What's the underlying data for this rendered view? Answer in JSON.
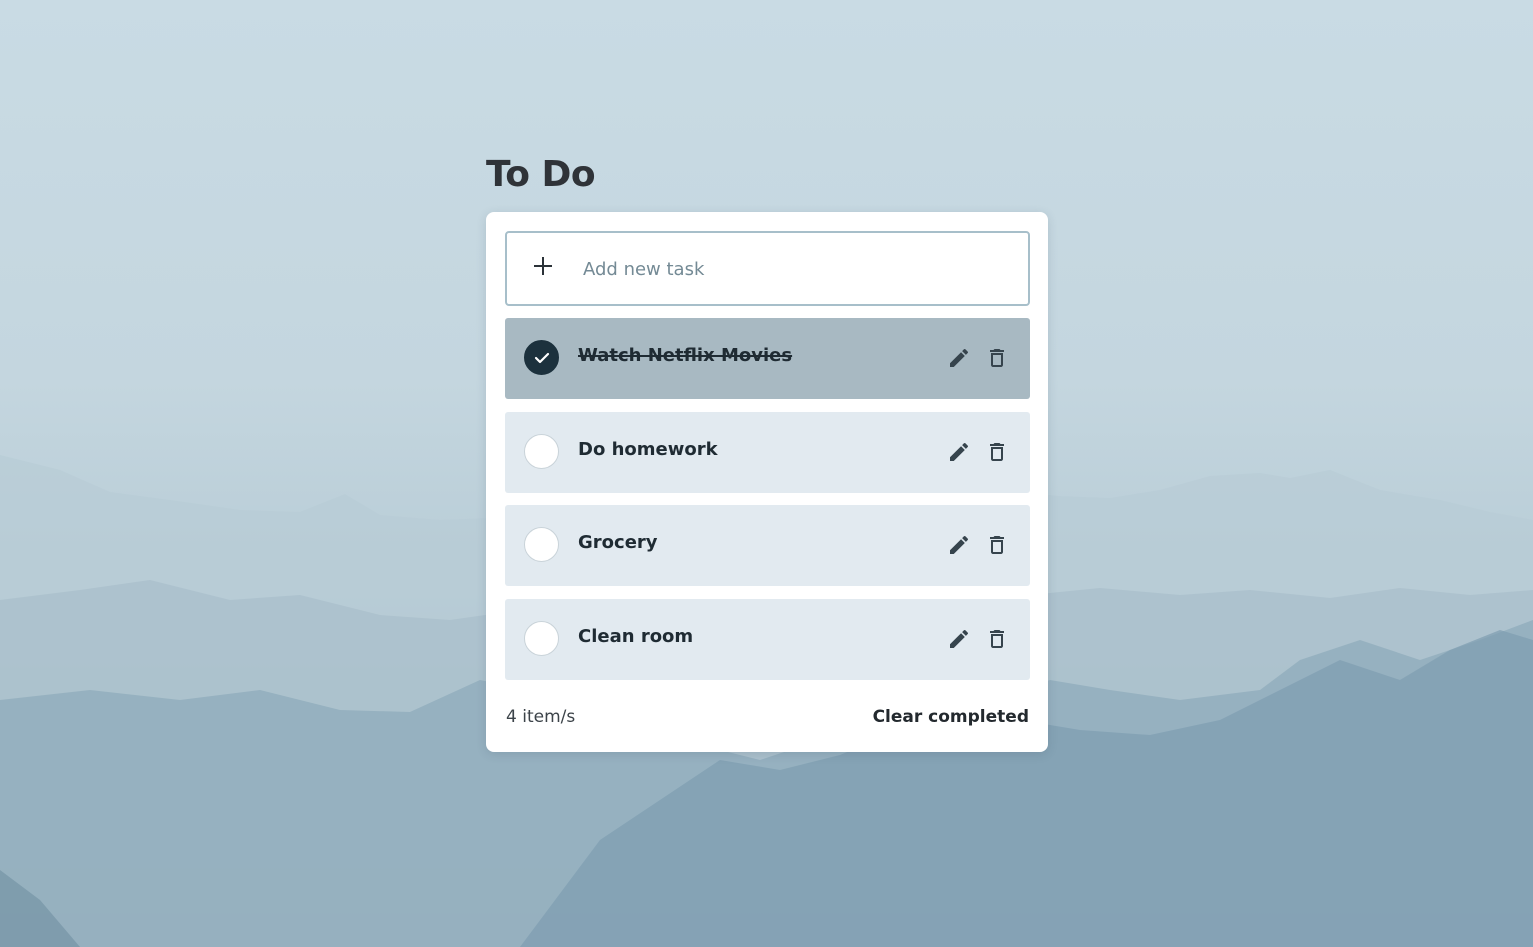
{
  "page": {
    "title": "To Do"
  },
  "add_task": {
    "placeholder": "Add new task",
    "value": "",
    "icon": "plus-icon"
  },
  "tasks": [
    {
      "label": "Watch Netflix Movies",
      "completed": true
    },
    {
      "label": "Do homework",
      "completed": false
    },
    {
      "label": "Grocery",
      "completed": false
    },
    {
      "label": "Clean room",
      "completed": false
    }
  ],
  "footer": {
    "count_text": "4 item/s",
    "clear_label": "Clear completed"
  },
  "icons": {
    "edit": "pencil-icon",
    "delete": "trash-icon",
    "check": "check-icon"
  },
  "colors": {
    "completed_bg": "#a8b9c2",
    "task_bg": "#e2eaf0",
    "checked_circle": "#1c313d",
    "text_dark": "#1f2b33"
  }
}
